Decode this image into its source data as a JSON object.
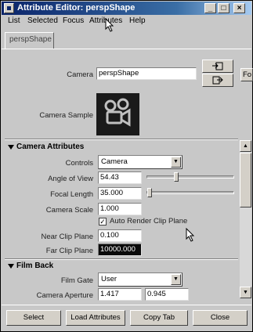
{
  "window": {
    "title": "Attribute Editor: perspShape"
  },
  "menubar": {
    "items": [
      "List",
      "Selected",
      "Focus",
      "Attributes",
      "Help"
    ]
  },
  "tabs": [
    "perspShape"
  ],
  "top": {
    "camera_label": "Camera",
    "camera_value": "perspShape",
    "side_button": "Fo",
    "sample_label": "Camera Sample"
  },
  "camera_attributes": {
    "title": "Camera Attributes",
    "controls_label": "Controls",
    "controls_value": "Camera",
    "angle_label": "Angle of View",
    "angle_value": "54.43",
    "focal_label": "Focal Length",
    "focal_value": "35.000",
    "scale_label": "Camera Scale",
    "scale_value": "1.000",
    "auto_clip_label": "Auto Render Clip Plane",
    "auto_clip_checked": true,
    "near_label": "Near Clip Plane",
    "near_value": "0.100",
    "far_label": "Far Clip Plane",
    "far_value": "10000.000"
  },
  "film_back": {
    "title": "Film Back",
    "gate_label": "Film Gate",
    "gate_value": "User",
    "aperture_label": "Camera Aperture",
    "aperture_x": "1.417",
    "aperture_y": "0.945"
  },
  "bottom_buttons": [
    "Select",
    "Load Attributes",
    "Copy Tab",
    "Close"
  ]
}
